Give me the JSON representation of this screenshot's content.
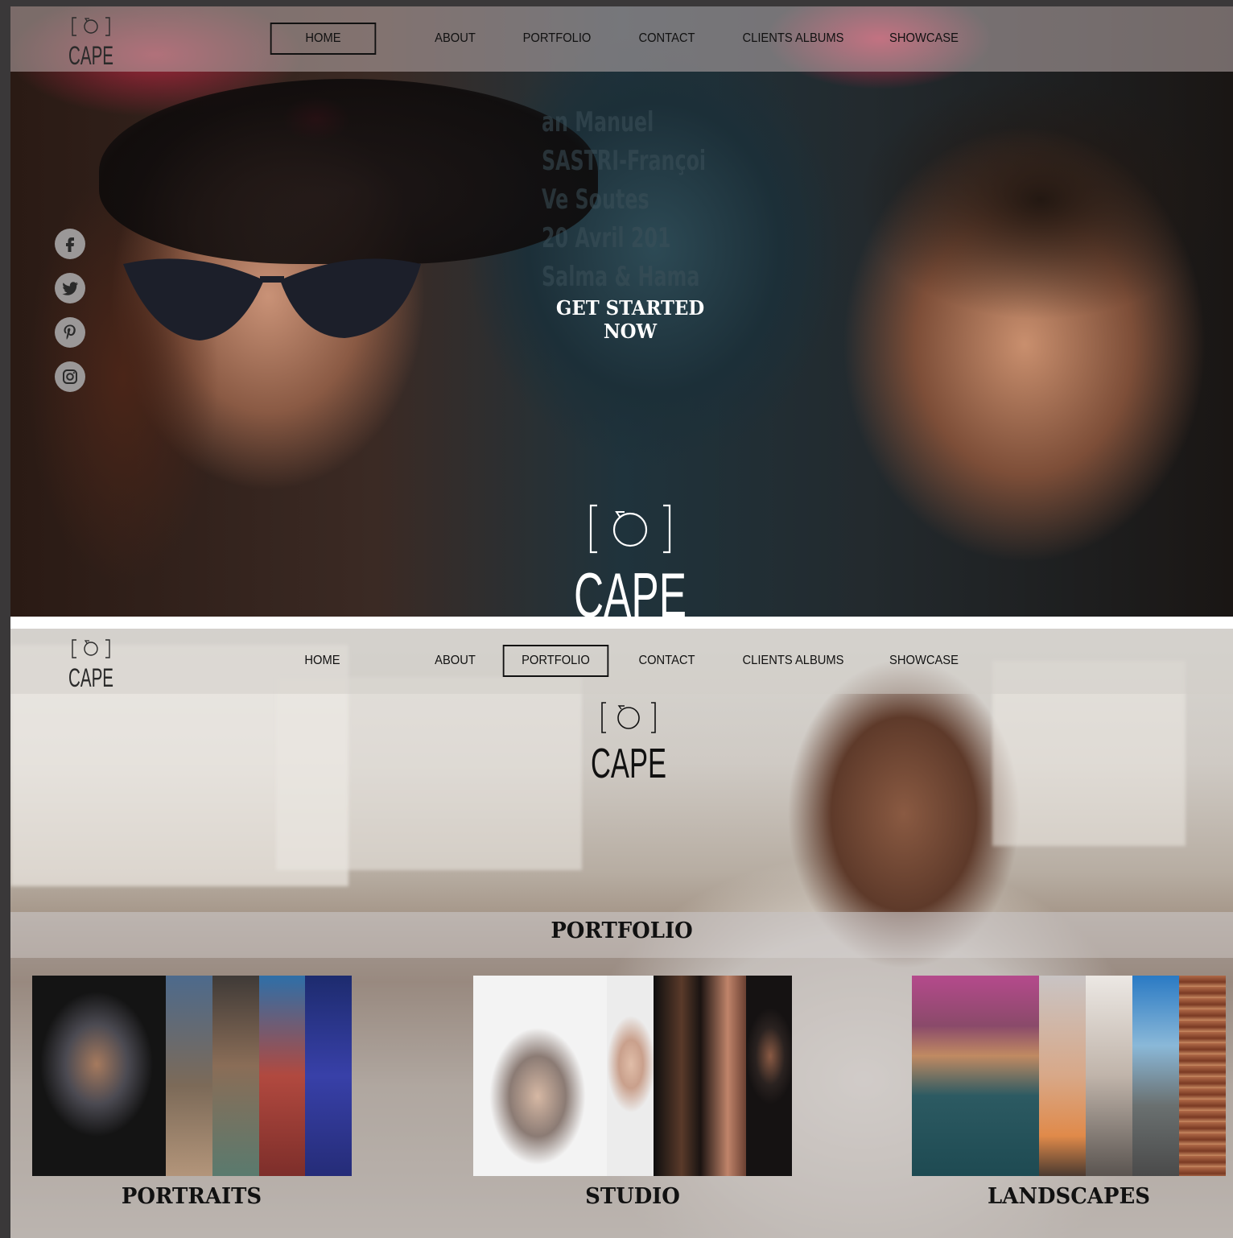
{
  "brand": {
    "logo_text": "CAPE"
  },
  "nav": {
    "items": [
      {
        "label": "HOME"
      },
      {
        "label": "ABOUT"
      },
      {
        "label": "PORTFOLIO"
      },
      {
        "label": "CONTACT"
      },
      {
        "label": "CLIENTS ALBUMS"
      },
      {
        "label": "SHOWCASE"
      }
    ]
  },
  "hero": {
    "active_nav": "HOME",
    "cta": "GET STARTED NOW",
    "background_sign": [
      "an Manuel",
      "SASTRI-Françoi",
      "Ve Soutes",
      "20 Avril 201",
      "Salma & Hama"
    ]
  },
  "social": {
    "icons": [
      "facebook-icon",
      "twitter-icon",
      "pinterest-icon",
      "instagram-icon"
    ]
  },
  "portfolio": {
    "active_nav": "PORTFOLIO",
    "title": "PORTFOLIO",
    "categories": [
      {
        "label": "PORTRAITS"
      },
      {
        "label": "STUDIO"
      },
      {
        "label": "LANDSCAPES"
      }
    ]
  },
  "colors": {
    "nav_overlay": "#beafaf",
    "text_dark": "#111111",
    "text_light": "#ffffff",
    "accent_red": "#e0284f"
  }
}
